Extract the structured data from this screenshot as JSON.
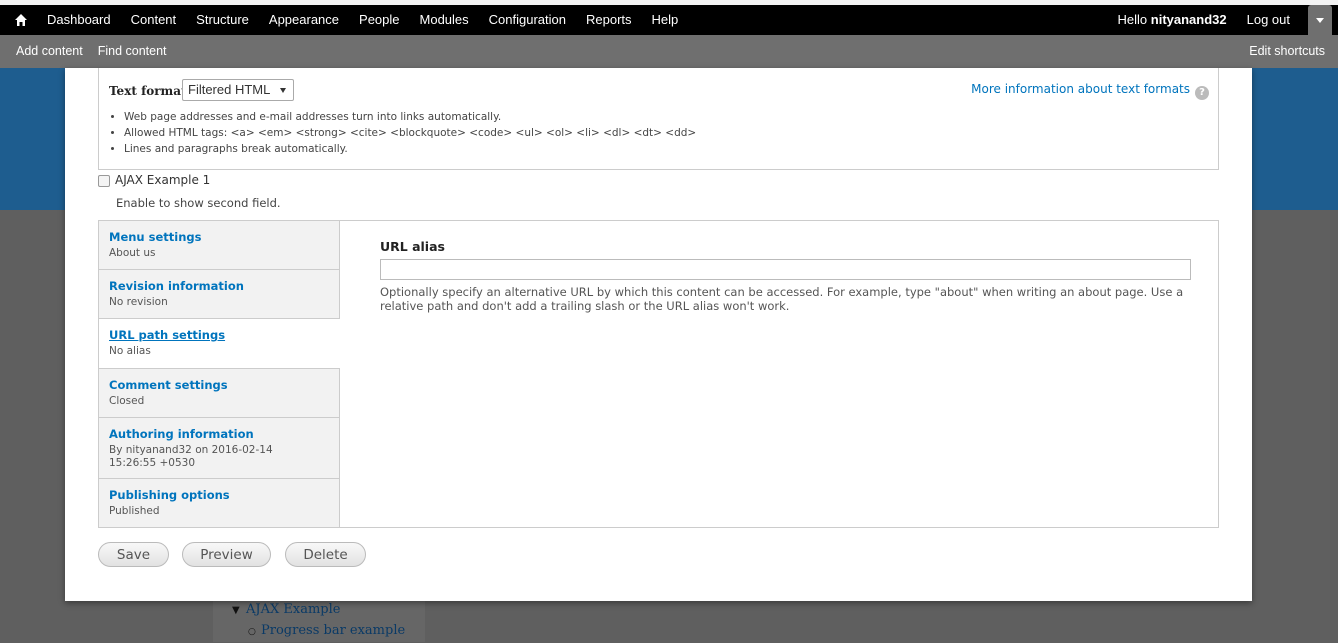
{
  "toolbar": {
    "menu": [
      "Dashboard",
      "Content",
      "Structure",
      "Appearance",
      "People",
      "Modules",
      "Configuration",
      "Reports",
      "Help"
    ],
    "hello_prefix": "Hello",
    "username": "nityanand32",
    "logout": "Log out"
  },
  "shortcuts": {
    "links": [
      "Add content",
      "Find content"
    ],
    "edit": "Edit shortcuts"
  },
  "text_format": {
    "label": "Text format",
    "selected": "Filtered HTML",
    "more_info": "More information about text formats",
    "tips": [
      "Web page addresses and e-mail addresses turn into links automatically.",
      "Allowed HTML tags: <a> <em> <strong> <cite> <blockquote> <code> <ul> <ol> <li> <dl> <dt> <dd>",
      "Lines and paragraphs break automatically."
    ]
  },
  "ajax": {
    "label": "AJAX Example 1",
    "description": "Enable to show second field."
  },
  "vertical_tabs": [
    {
      "title": "Menu settings",
      "summary": "About us"
    },
    {
      "title": "Revision information",
      "summary": "No revision"
    },
    {
      "title": "URL path settings",
      "summary": "No alias"
    },
    {
      "title": "Comment settings",
      "summary": "Closed"
    },
    {
      "title": "Authoring information",
      "summary": "By nityanand32 on 2016-02-14 15:26:55 +0530"
    },
    {
      "title": "Publishing options",
      "summary": "Published"
    }
  ],
  "pane": {
    "label": "URL alias",
    "value": "",
    "description": "Optionally specify an alternative URL by which this content can be accessed. For example, type \"about\" when writing an about page. Use a relative path and don't add a trailing slash or the URL alias won't work."
  },
  "buttons": {
    "save": "Save",
    "preview": "Preview",
    "delete": "Delete"
  },
  "background_nav": {
    "parent": "AJAX Example",
    "child": "Progress bar example"
  },
  "colors": {
    "toolbar": "#000000",
    "shortcuts_bar": "#6f6f6f",
    "header_blue": "#1e5d8f",
    "link": "#0074bd"
  }
}
